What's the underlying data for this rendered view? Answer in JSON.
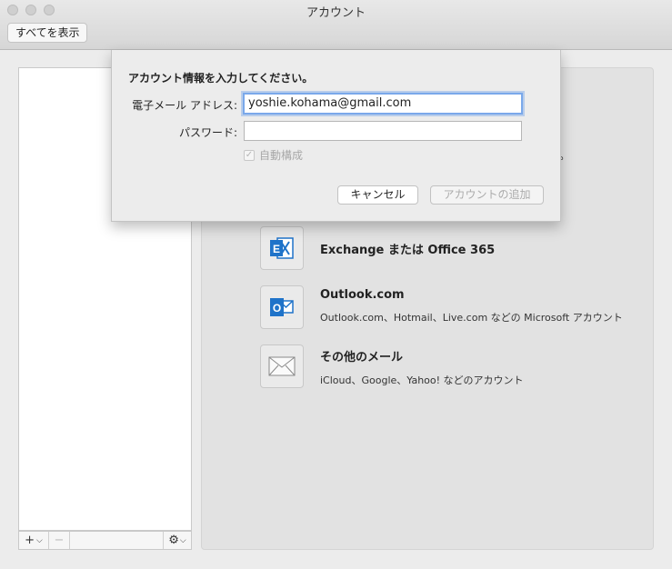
{
  "window": {
    "title": "アカウント",
    "show_all_label": "すべてを表示"
  },
  "sheet": {
    "heading": "アカウント情報を入力してください。",
    "email_label": "電子メール アドレス:",
    "email_value": "yoshie.kohama@gmail.com",
    "password_label": "パスワード:",
    "password_value": "",
    "auto_config_label": "自動構成",
    "auto_config_checked": true,
    "cancel_label": "キャンセル",
    "add_account_label": "アカウントの追加"
  },
  "list_toolbar": {
    "add_label": "+",
    "remove_label": "−",
    "gear_label": "⚙"
  },
  "providers": [
    {
      "icon": "exchange-icon",
      "title": "Exchange または Office 365",
      "desc": ""
    },
    {
      "icon": "outlook-icon",
      "title": "Outlook.com",
      "desc": "Outlook.com、Hotmail、Live.com などの Microsoft アカウント"
    },
    {
      "icon": "mail-envelope-icon",
      "title": "その他のメール",
      "desc": "iCloud、Google、Yahoo! などのアカウント"
    }
  ],
  "partial_text": "い。",
  "colors": {
    "accent": "#1f73c9",
    "focus_ring": "#7aa8ea"
  }
}
